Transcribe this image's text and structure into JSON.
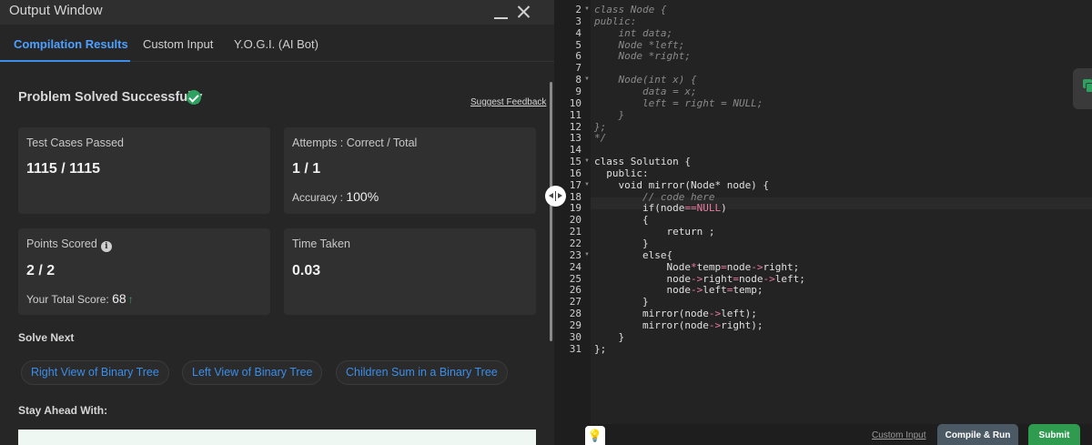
{
  "window": {
    "title": "Output Window"
  },
  "tabs": [
    {
      "label": "Compilation Results",
      "active": true
    },
    {
      "label": "Custom Input",
      "active": false
    },
    {
      "label": "Y.O.G.I. (AI Bot)",
      "active": false
    }
  ],
  "result": {
    "status": "Problem Solved Successfully",
    "feedback_link": "Suggest Feedback"
  },
  "cards": {
    "test_cases": {
      "label": "Test Cases Passed",
      "value": "1115 / 1115"
    },
    "attempts": {
      "label": "Attempts : Correct / Total",
      "value": "1 / 1",
      "accuracy_label": "Accuracy :",
      "accuracy_value": "100%"
    },
    "points": {
      "label": "Points Scored",
      "value": "2 / 2",
      "total_label": "Your Total Score:",
      "total_value": "68"
    },
    "time": {
      "label": "Time Taken",
      "value": "0.03"
    }
  },
  "solve_next": {
    "title": "Solve Next",
    "items": [
      "Right View of Binary Tree",
      "Left View of Binary Tree",
      "Children Sum in a Binary Tree"
    ]
  },
  "stay_ahead": {
    "title": "Stay Ahead With:"
  },
  "editor": {
    "line_numbers": [
      "2",
      "3",
      "4",
      "5",
      "6",
      "7",
      "8",
      "9",
      "10",
      "11",
      "12",
      "13",
      "14",
      "15",
      "16",
      "17",
      "18",
      "19",
      "20",
      "21",
      "22",
      "23",
      "24",
      "25",
      "26",
      "27",
      "28",
      "29",
      "30",
      "31"
    ],
    "lines": [
      "class Node {",
      "public:",
      "    int data;",
      "    Node *left;",
      "    Node *right;",
      "",
      "    Node(int x) {",
      "        data = x;",
      "        left = right = NULL;",
      "    }",
      "};",
      "*/",
      "",
      "class Solution {",
      "  public:",
      "    void mirror(Node* node) {",
      "        // code here",
      "        if(node==NULL)",
      "        {",
      "            return ;",
      "        }",
      "        else{",
      "            Node*temp=node->right;",
      "            node->right=node->left;",
      "            node->left=temp;",
      "        }",
      "        mirror(node->left);",
      "        mirror(node->right);",
      "    }",
      "};"
    ]
  },
  "bottom": {
    "custom_input": "Custom Input",
    "compile": "Compile & Run",
    "submit": "Submit"
  }
}
